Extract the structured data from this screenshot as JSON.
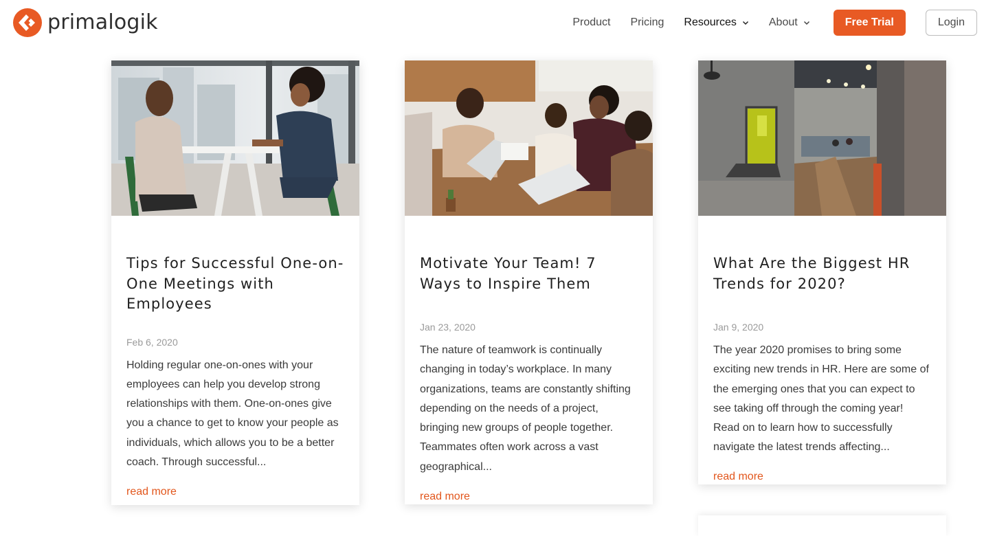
{
  "brand": {
    "name": "primalogik",
    "accent": "#e85a24",
    "logo_icon": "primalogik-logo-icon"
  },
  "nav": {
    "items": [
      {
        "label": "Product",
        "dropdown": false
      },
      {
        "label": "Pricing",
        "dropdown": false
      },
      {
        "label": "Resources",
        "dropdown": true
      },
      {
        "label": "About",
        "dropdown": true
      }
    ],
    "trial_label": "Free Trial",
    "login_label": "Login"
  },
  "posts": [
    {
      "title": "Tips for Successful One-on-One Meetings with Employees",
      "date": "Feb 6, 2020",
      "excerpt": "Holding regular one-on-ones with your employees can help you develop strong relationships with them. One-on-ones give you a chance to get to know your people as individuals, which allows you to be a better coach.  Through successful...",
      "read_more": "read more",
      "image": "two-women-meeting-photo"
    },
    {
      "title": "Motivate Your Team! 7 Ways to Inspire Them",
      "date": "Jan 23, 2020",
      "excerpt": "The nature of teamwork is continually changing in today’s workplace. In many organizations, teams are constantly shifting depending on the needs of a project, bringing new groups of people together. Teammates often work across a vast geographical...",
      "read_more": "read more",
      "image": "team-meeting-laptops-photo"
    },
    {
      "title": "What Are the Biggest HR Trends for 2020?",
      "date": "Jan 9, 2020",
      "excerpt": "The year 2020 promises to bring some exciting new trends in HR. Here are some of the emerging ones that you can expect to see taking off through the coming year! Read on to learn how to successfully navigate the latest trends affecting...",
      "read_more": "read more",
      "image": "open-office-photo"
    }
  ]
}
